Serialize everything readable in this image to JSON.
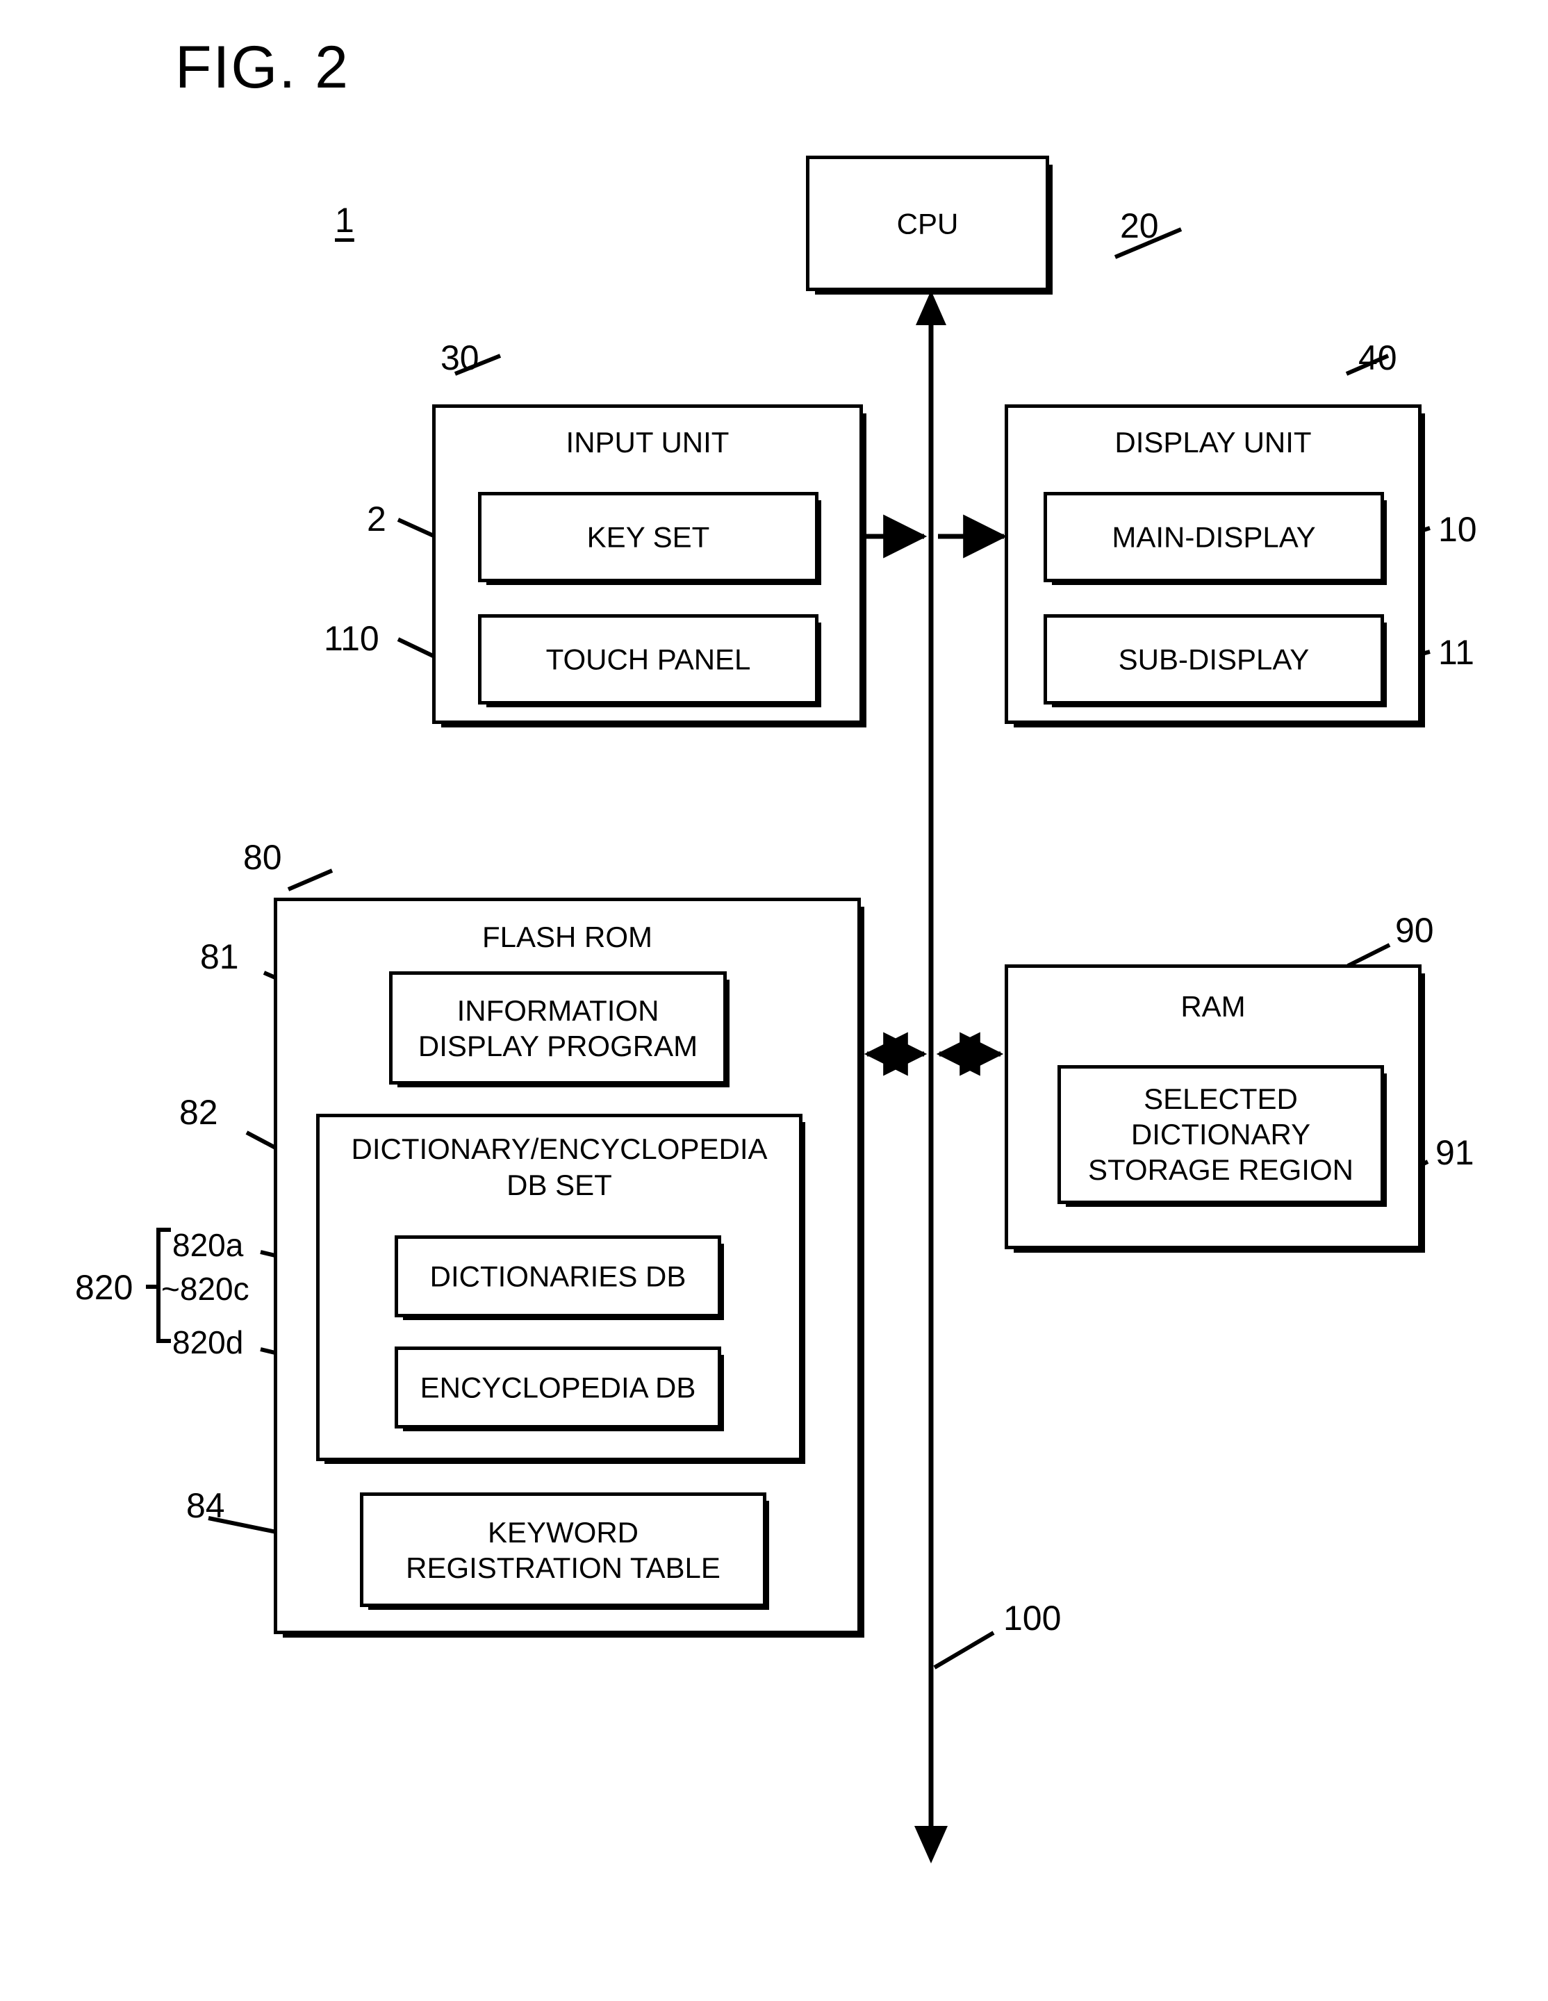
{
  "figure": {
    "title": "FIG. 2",
    "system_ref": "1"
  },
  "blocks": {
    "cpu": {
      "title": "CPU",
      "ref": "20"
    },
    "input_unit": {
      "title": "INPUT UNIT",
      "ref": "30",
      "children": [
        {
          "label": "KEY SET",
          "ref": "2"
        },
        {
          "label": "TOUCH PANEL",
          "ref": "110"
        }
      ]
    },
    "display_unit": {
      "title": "DISPLAY UNIT",
      "ref": "40",
      "children": [
        {
          "label": "MAIN-DISPLAY",
          "ref": "10"
        },
        {
          "label": "SUB-DISPLAY",
          "ref": "11"
        }
      ]
    },
    "flash_rom": {
      "title": "FLASH ROM",
      "ref": "80",
      "children": [
        {
          "label": "INFORMATION\nDISPLAY PROGRAM",
          "ref": "81"
        },
        {
          "label": "DICTIONARY/ENCYCLOPEDIA\nDB SET",
          "ref": "82",
          "children": [
            {
              "label": "DICTIONARIES DB",
              "ref": "820a",
              "ref2": "~820c"
            },
            {
              "label": "ENCYCLOPEDIA DB",
              "ref": "820d"
            }
          ],
          "group_ref": "820"
        },
        {
          "label": "KEYWORD\nREGISTRATION TABLE",
          "ref": "84"
        }
      ]
    },
    "ram": {
      "title": "RAM",
      "ref": "90",
      "children": [
        {
          "label": "SELECTED\nDICTIONARY\nSTORAGE REGION",
          "ref": "91"
        }
      ]
    },
    "bus": {
      "ref": "100"
    }
  },
  "labels": {
    "title": "FIG. 2",
    "system_ref": "1",
    "cpu": "CPU",
    "cpu_ref": "20",
    "input_unit": "INPUT UNIT",
    "input_unit_ref": "30",
    "key_set": "KEY SET",
    "key_set_ref": "2",
    "touch_panel": "TOUCH PANEL",
    "touch_panel_ref": "110",
    "display_unit": "DISPLAY UNIT",
    "display_unit_ref": "40",
    "main_display": "MAIN-DISPLAY",
    "main_display_ref": "10",
    "sub_display": "SUB-DISPLAY",
    "sub_display_ref": "11",
    "flash_rom": "FLASH ROM",
    "flash_rom_ref": "80",
    "info_display_program_l1": "INFORMATION",
    "info_display_program_l2": "DISPLAY PROGRAM",
    "info_display_program_ref": "81",
    "db_set_l1": "DICTIONARY/ENCYCLOPEDIA",
    "db_set_l2": "DB SET",
    "db_set_ref": "82",
    "dictionaries_db": "DICTIONARIES DB",
    "dictionaries_db_ref_a": "820a",
    "dictionaries_db_ref_c": "~820c",
    "encyclopedia_db": "ENCYCLOPEDIA DB",
    "encyclopedia_db_ref": "820d",
    "db_group_ref": "820",
    "keyword_table_l1": "KEYWORD",
    "keyword_table_l2": "REGISTRATION TABLE",
    "keyword_table_ref": "84",
    "ram": "RAM",
    "ram_ref": "90",
    "selected_dict_l1": "SELECTED",
    "selected_dict_l2": "DICTIONARY",
    "selected_dict_l3": "STORAGE REGION",
    "selected_dict_ref": "91",
    "bus_ref": "100"
  },
  "colors": {
    "line": "#000000",
    "background": "#ffffff"
  }
}
